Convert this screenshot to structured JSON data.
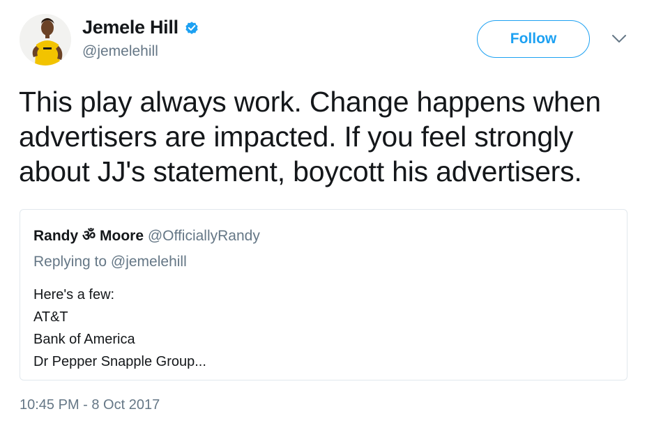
{
  "header": {
    "name": "Jemele Hill",
    "handle": "@jemelehill",
    "follow_label": "Follow"
  },
  "tweet": {
    "lines": [
      "This play always work. Change happens when",
      "advertisers are impacted. If you feel strongly",
      "about JJ's statement, boycott his advertisers."
    ],
    "timestamp": "10:45 PM - 8 Oct 2017"
  },
  "quote": {
    "name": "Randy ॐ Moore",
    "handle": "@OfficiallyRandy",
    "replying_to": "Replying to @jemelehill",
    "body_lines": [
      "Here's a few:",
      "AT&T",
      "Bank of America",
      "Dr Pepper Snapple Group..."
    ]
  },
  "icons": {
    "verified": "verified-badge-icon",
    "caret": "chevron-down-icon"
  },
  "colors": {
    "accent": "#1da1f2",
    "secondary_text": "#657786",
    "border": "#e1e8ed"
  }
}
